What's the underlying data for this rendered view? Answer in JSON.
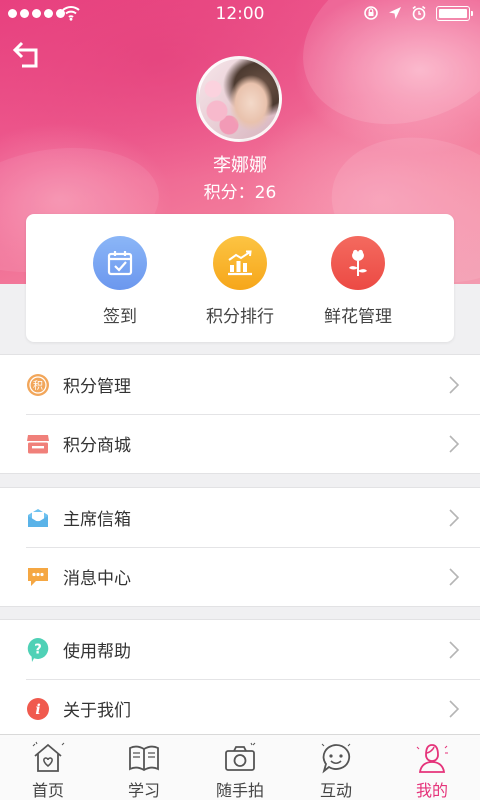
{
  "status_bar": {
    "time": "12:00"
  },
  "profile": {
    "name": "李娜娜",
    "points_text": "积分：26"
  },
  "quick_actions": [
    {
      "label": "签到",
      "icon": "calendar-check-icon",
      "color": "#7aa7f5"
    },
    {
      "label": "积分排行",
      "icon": "bar-chart-icon",
      "color": "#f9b52d"
    },
    {
      "label": "鲜花管理",
      "icon": "rose-icon",
      "color": "#f0504e"
    }
  ],
  "menu": {
    "group1": [
      {
        "label": "积分管理",
        "icon": "points-medal-icon",
        "color": "#f2a65a"
      },
      {
        "label": "积分商城",
        "icon": "shop-icon",
        "color": "#f0807a"
      }
    ],
    "group2": [
      {
        "label": "主席信箱",
        "icon": "mailbox-icon",
        "color": "#6fc2f0"
      },
      {
        "label": "消息中心",
        "icon": "message-icon",
        "color": "#f5a743"
      }
    ],
    "group3": [
      {
        "label": "使用帮助",
        "icon": "help-icon",
        "color": "#4fd1b6"
      },
      {
        "label": "关于我们",
        "icon": "info-icon",
        "color": "#f05a4e"
      }
    ]
  },
  "tabs": [
    {
      "label": "首页",
      "icon": "home-icon",
      "active": false
    },
    {
      "label": "学习",
      "icon": "book-icon",
      "active": false
    },
    {
      "label": "随手拍",
      "icon": "camera-icon",
      "active": false
    },
    {
      "label": "互动",
      "icon": "chat-face-icon",
      "active": false
    },
    {
      "label": "我的",
      "icon": "person-icon",
      "active": true
    }
  ],
  "colors": {
    "accent": "#e5337a",
    "header_start": "#e8407f",
    "header_end": "#f39bb0"
  }
}
